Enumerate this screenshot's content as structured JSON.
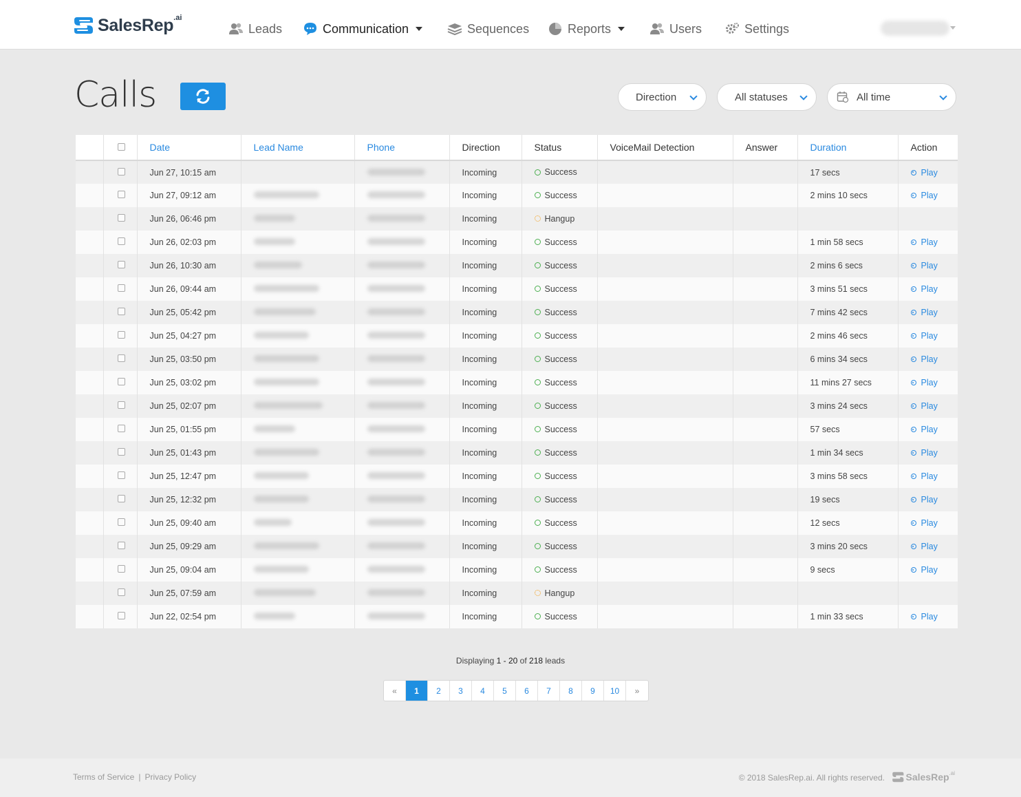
{
  "app": {
    "brand_name": "SalesRep",
    "brand_suffix": ".ai",
    "accent_color": "#1e8fe1"
  },
  "nav": {
    "items": [
      {
        "label": "Leads",
        "icon": "users-icon"
      },
      {
        "label": "Communication",
        "icon": "chat-bubble-icon",
        "active": true,
        "dropdown": true
      },
      {
        "label": "Sequences",
        "icon": "layers-icon"
      },
      {
        "label": "Reports",
        "icon": "pie-chart-icon",
        "dropdown": true
      },
      {
        "label": "Users",
        "icon": "users-icon"
      },
      {
        "label": "Settings",
        "icon": "gear-icon"
      }
    ]
  },
  "page": {
    "title": "Calls"
  },
  "filters": {
    "direction": "Direction",
    "status": "All statuses",
    "time": "All time"
  },
  "table": {
    "columns": [
      "",
      "",
      "Date",
      "Lead Name",
      "Phone",
      "Direction",
      "Status",
      "VoiceMail Detection",
      "Answer",
      "Duration",
      "Action"
    ],
    "rows": [
      {
        "date": "Jun 27, 10:15 am",
        "direction": "Incoming",
        "status": "Success",
        "duration": "17 secs",
        "action": "Play"
      },
      {
        "date": "Jun 27, 09:12 am",
        "direction": "Incoming",
        "status": "Success",
        "duration": "2 mins 10 secs",
        "action": "Play"
      },
      {
        "date": "Jun 26, 06:46 pm",
        "direction": "Incoming",
        "status": "Hangup",
        "duration": "",
        "action": ""
      },
      {
        "date": "Jun 26, 02:03 pm",
        "direction": "Incoming",
        "status": "Success",
        "duration": "1 min 58 secs",
        "action": "Play"
      },
      {
        "date": "Jun 26, 10:30 am",
        "direction": "Incoming",
        "status": "Success",
        "duration": "2 mins 6 secs",
        "action": "Play"
      },
      {
        "date": "Jun 26, 09:44 am",
        "direction": "Incoming",
        "status": "Success",
        "duration": "3 mins 51 secs",
        "action": "Play"
      },
      {
        "date": "Jun 25, 05:42 pm",
        "direction": "Incoming",
        "status": "Success",
        "duration": "7 mins 42 secs",
        "action": "Play"
      },
      {
        "date": "Jun 25, 04:27 pm",
        "direction": "Incoming",
        "status": "Success",
        "duration": "2 mins 46 secs",
        "action": "Play"
      },
      {
        "date": "Jun 25, 03:50 pm",
        "direction": "Incoming",
        "status": "Success",
        "duration": "6 mins 34 secs",
        "action": "Play"
      },
      {
        "date": "Jun 25, 03:02 pm",
        "direction": "Incoming",
        "status": "Success",
        "duration": "11 mins 27 secs",
        "action": "Play"
      },
      {
        "date": "Jun 25, 02:07 pm",
        "direction": "Incoming",
        "status": "Success",
        "duration": "3 mins 24 secs",
        "action": "Play"
      },
      {
        "date": "Jun 25, 01:55 pm",
        "direction": "Incoming",
        "status": "Success",
        "duration": "57 secs",
        "action": "Play"
      },
      {
        "date": "Jun 25, 01:43 pm",
        "direction": "Incoming",
        "status": "Success",
        "duration": "1 min 34 secs",
        "action": "Play"
      },
      {
        "date": "Jun 25, 12:47 pm",
        "direction": "Incoming",
        "status": "Success",
        "duration": "3 mins 58 secs",
        "action": "Play"
      },
      {
        "date": "Jun 25, 12:32 pm",
        "direction": "Incoming",
        "status": "Success",
        "duration": "19 secs",
        "action": "Play"
      },
      {
        "date": "Jun 25, 09:40 am",
        "direction": "Incoming",
        "status": "Success",
        "duration": "12 secs",
        "action": "Play"
      },
      {
        "date": "Jun 25, 09:29 am",
        "direction": "Incoming",
        "status": "Success",
        "duration": "3 mins 20 secs",
        "action": "Play"
      },
      {
        "date": "Jun 25, 09:04 am",
        "direction": "Incoming",
        "status": "Success",
        "duration": "9 secs",
        "action": "Play"
      },
      {
        "date": "Jun 25, 07:59 am",
        "direction": "Incoming",
        "status": "Hangup",
        "duration": "",
        "action": ""
      },
      {
        "date": "Jun 22, 02:54 pm",
        "direction": "Incoming",
        "status": "Success",
        "duration": "1 min 33 secs",
        "action": "Play"
      }
    ]
  },
  "pagination": {
    "prefix": "Displaying",
    "range": "1 - 20",
    "of": "of",
    "total": "218",
    "suffix": "leads",
    "prev": "«",
    "next": "»",
    "pages": [
      "1",
      "2",
      "3",
      "4",
      "5",
      "6",
      "7",
      "8",
      "9",
      "10"
    ],
    "current": "1"
  },
  "footer": {
    "terms": "Terms of Service",
    "separator": "|",
    "privacy": "Privacy Policy",
    "copyright": "© 2018 SalesRep.ai. All rights reserved.",
    "logo_text": "SalesRep",
    "logo_suffix": ".ai"
  }
}
